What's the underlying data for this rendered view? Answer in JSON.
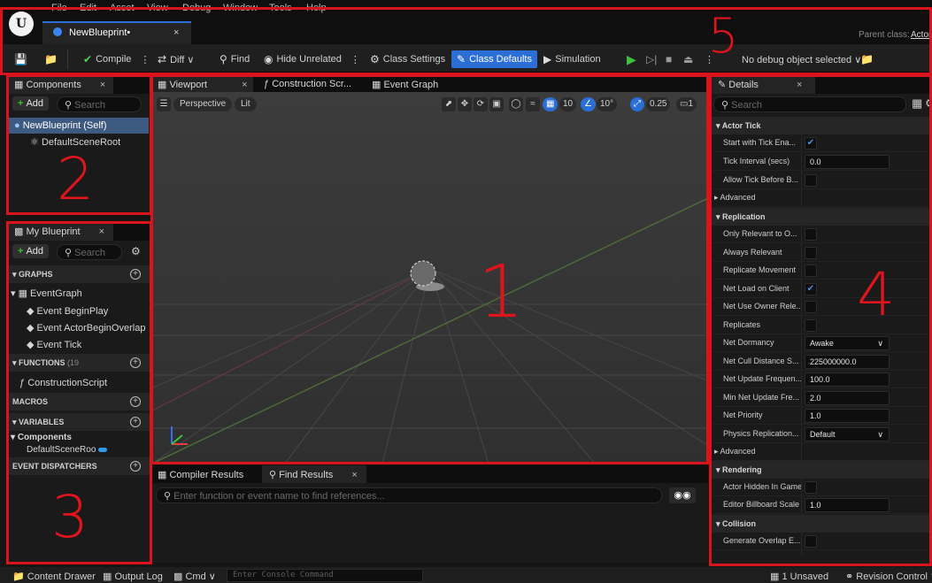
{
  "menu": [
    "File",
    "Edit",
    "Asset",
    "View",
    "Debug",
    "Window",
    "Tools",
    "Help"
  ],
  "doc_tab": {
    "label": "NewBlueprint•",
    "close": "×"
  },
  "parent_class": {
    "label": "Parent class:",
    "value": "Actor"
  },
  "toolbar": {
    "compile": "Compile",
    "diff": "Diff ∨",
    "find": "Find",
    "hide_unrelated": "Hide Unrelated",
    "class_settings": "Class Settings",
    "class_defaults": "Class Defaults",
    "simulation": "Simulation",
    "debug_object": "No debug object selected ∨"
  },
  "components_panel": {
    "tab": "Components",
    "add": "Add",
    "search_placeholder": "Search",
    "items": [
      "NewBlueprint (Self)",
      "DefaultSceneRoot"
    ]
  },
  "my_blueprint": {
    "tab": "My Blueprint",
    "add": "Add",
    "search_placeholder": "Search",
    "graphs_header": "GRAPHS",
    "event_graph": "EventGraph",
    "events": [
      "Event BeginPlay",
      "Event ActorBeginOverlap",
      "Event Tick"
    ],
    "functions_header": "FUNCTIONS",
    "functions_count": "(19",
    "construction_script": "ConstructionScript",
    "macros_header": "MACROS",
    "variables_header": "VARIABLES",
    "components_group": "Components",
    "default_scene_root": "DefaultSceneRoo",
    "dispatchers_header": "EVENT DISPATCHERS"
  },
  "editor_tabs": [
    "Viewport",
    "Construction Scr...",
    "Event Graph"
  ],
  "viewport": {
    "perspective": "Perspective",
    "lit": "Lit",
    "grid_snap": "10",
    "angle_snap": "10°",
    "scale_snap": "0.25",
    "camera_speed": "1"
  },
  "bottom_tabs": [
    "Compiler Results",
    "Find Results"
  ],
  "find_placeholder": "Enter function or event name to find references...",
  "details": {
    "tab": "Details",
    "search_placeholder": "Search",
    "sections": {
      "actor_tick": "Actor Tick",
      "replication": "Replication",
      "rendering": "Rendering",
      "collision": "Collision"
    },
    "advanced": "Advanced",
    "rows": {
      "start_tick": "Start with Tick Ena...",
      "tick_interval": "Tick Interval (secs)",
      "tick_interval_val": "0.0",
      "allow_tick": "Allow Tick Before B...",
      "only_relevant": "Only Relevant to O...",
      "always_relevant": "Always Relevant",
      "replicate_movement": "Replicate Movement",
      "net_load": "Net Load on Client",
      "net_use_owner": "Net Use Owner Rele...",
      "replicates": "Replicates",
      "net_dormancy": "Net Dormancy",
      "net_dormancy_val": "Awake",
      "net_cull": "Net Cull Distance S...",
      "net_cull_val": "225000000.0",
      "net_update": "Net Update Frequen...",
      "net_update_val": "100.0",
      "min_net_update": "Min Net Update Fre...",
      "min_net_update_val": "2.0",
      "net_priority": "Net Priority",
      "net_priority_val": "1.0",
      "physics_rep": "Physics Replication...",
      "physics_rep_val": "Default",
      "actor_hidden": "Actor Hidden In Game",
      "billboard_scale": "Editor Billboard Scale",
      "billboard_scale_val": "1.0",
      "gen_overlap": "Generate Overlap E..."
    }
  },
  "statusbar": {
    "content_drawer": "Content Drawer",
    "output_log": "Output Log",
    "cmd": "Cmd ∨",
    "console_placeholder": "Enter Console Command",
    "unsaved": "1 Unsaved",
    "revision": "Revision Control ∨"
  },
  "region_numbers": [
    "1",
    "2",
    "3",
    "4",
    "5"
  ],
  "colors": {
    "accent_blue": "#2b6fd6",
    "annotation_red": "#d9141c",
    "play_green": "#3fbe3f"
  }
}
